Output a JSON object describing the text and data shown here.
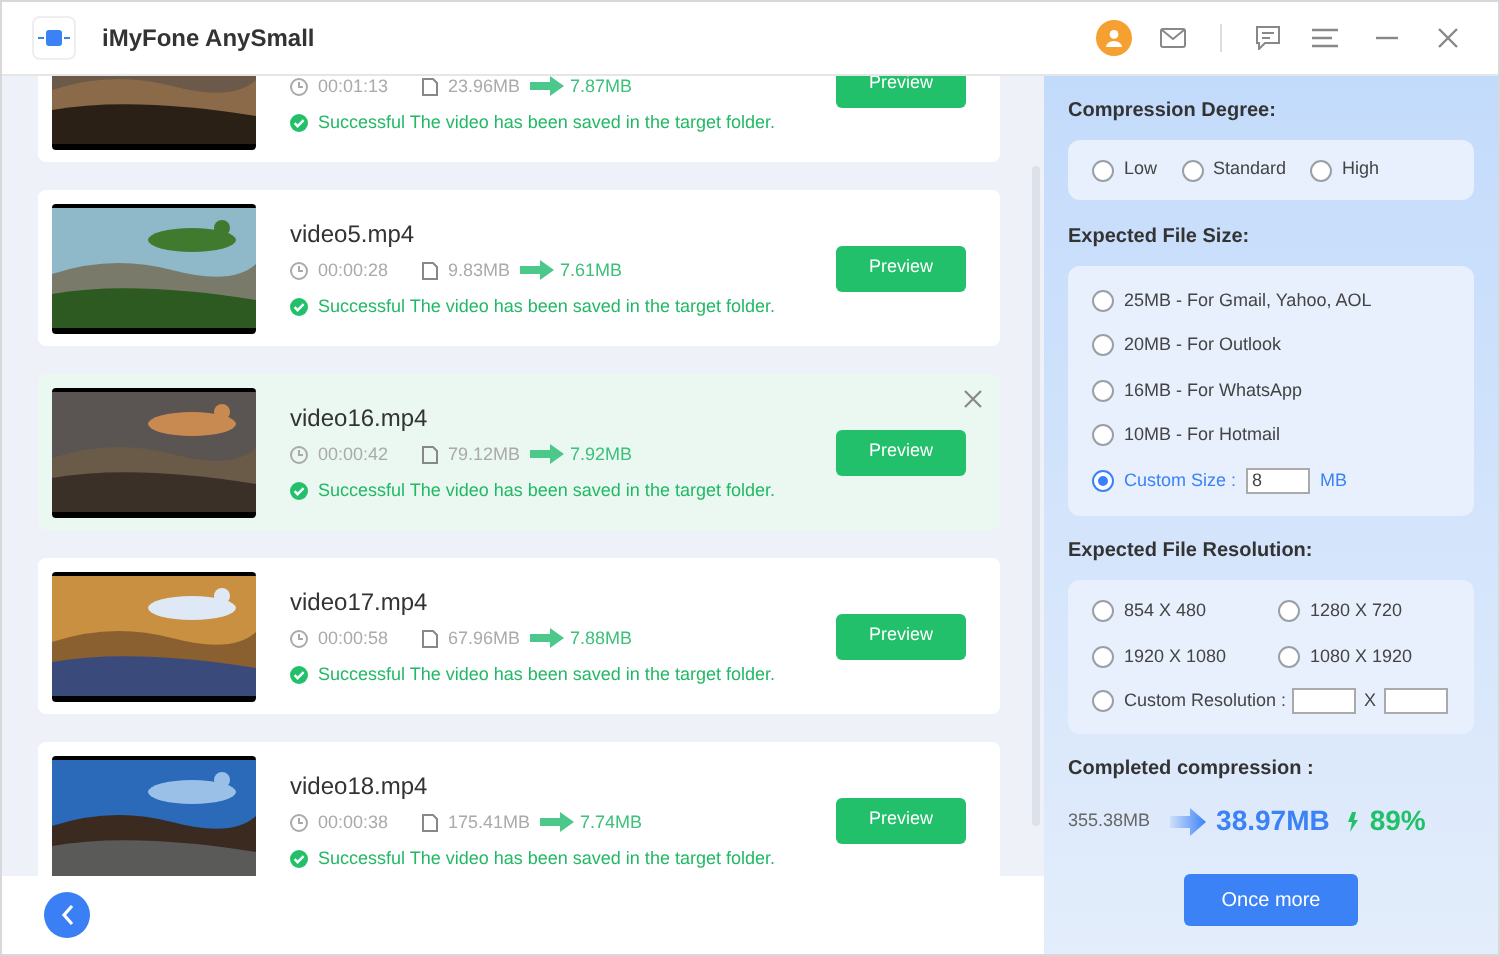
{
  "window": {
    "title": "iMyFone AnySmall"
  },
  "videos": [
    {
      "duration": "00:01:13",
      "original_size": "23.96MB",
      "compressed_size": "7.87MB",
      "status": "Successful The video has been saved in the target folder.",
      "button": "Preview",
      "selected": false
    },
    {
      "name": "video5.mp4",
      "duration": "00:00:28",
      "original_size": "9.83MB",
      "compressed_size": "7.61MB",
      "status": "Successful The video has been saved in the target folder.",
      "button": "Preview",
      "selected": false
    },
    {
      "name": "video16.mp4",
      "duration": "00:00:42",
      "original_size": "79.12MB",
      "compressed_size": "7.92MB",
      "status": "Successful The video has been saved in the target folder.",
      "button": "Preview",
      "selected": true
    },
    {
      "name": "video17.mp4",
      "duration": "00:00:58",
      "original_size": "67.96MB",
      "compressed_size": "7.88MB",
      "status": "Successful The video has been saved in the target folder.",
      "button": "Preview",
      "selected": false
    },
    {
      "name": "video18.mp4",
      "duration": "00:00:38",
      "original_size": "175.41MB",
      "compressed_size": "7.74MB",
      "status": "Successful The video has been saved in the target folder.",
      "button": "Preview",
      "selected": false
    }
  ],
  "compression_degree": {
    "title": "Compression Degree:",
    "options": [
      {
        "label": "Low",
        "selected": false
      },
      {
        "label": "Standard",
        "selected": false
      },
      {
        "label": "High",
        "selected": false
      }
    ]
  },
  "file_size": {
    "title": "Expected File Size:",
    "options": [
      {
        "label": "25MB - For Gmail, Yahoo, AOL",
        "selected": false
      },
      {
        "label": "20MB - For Outlook",
        "selected": false
      },
      {
        "label": "16MB - For WhatsApp",
        "selected": false
      },
      {
        "label": "10MB - For Hotmail",
        "selected": false
      }
    ],
    "custom": {
      "label": "Custom Size :",
      "value": "8",
      "unit": "MB",
      "selected": true
    }
  },
  "resolution": {
    "title": "Expected File Resolution:",
    "options": [
      {
        "label": "854 X 480",
        "selected": false
      },
      {
        "label": "1280 X 720",
        "selected": false
      },
      {
        "label": "1920 X 1080",
        "selected": false
      },
      {
        "label": "1080 X 1920",
        "selected": false
      }
    ],
    "custom": {
      "label": "Custom Resolution :",
      "separator": "X",
      "selected": false
    }
  },
  "completed": {
    "title": "Completed compression :",
    "original": "355.38MB",
    "compressed": "38.97MB",
    "saving": "89%"
  },
  "once_more_button": "Once more"
}
